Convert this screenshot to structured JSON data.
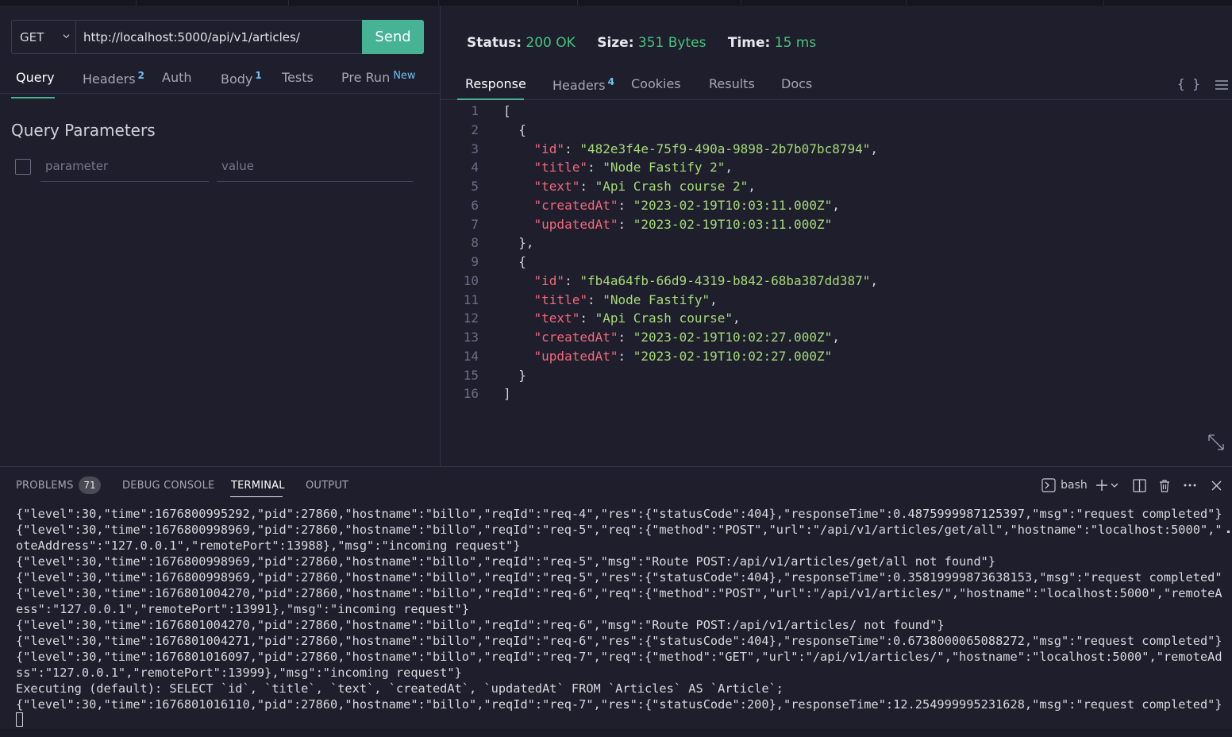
{
  "request": {
    "method": "GET",
    "url": "http://localhost:5000/api/v1/articles/",
    "send_label": "Send"
  },
  "request_tabs": [
    {
      "label": "Query",
      "count": ""
    },
    {
      "label": "Headers",
      "count": "2"
    },
    {
      "label": "Auth",
      "count": ""
    },
    {
      "label": "Body",
      "count": "1"
    },
    {
      "label": "Tests",
      "count": ""
    },
    {
      "label": "Pre Run",
      "count": "",
      "tag": "New"
    }
  ],
  "query_params": {
    "title": "Query Parameters",
    "param_placeholder": "parameter",
    "value_placeholder": "value"
  },
  "response_meta": {
    "status_label": "Status:",
    "status_value": "200 OK",
    "size_label": "Size:",
    "size_value": "351 Bytes",
    "time_label": "Time:",
    "time_value": "15 ms"
  },
  "response_tabs": [
    {
      "label": "Response",
      "count": ""
    },
    {
      "label": "Headers",
      "count": "4"
    },
    {
      "label": "Cookies",
      "count": ""
    },
    {
      "label": "Results",
      "count": ""
    },
    {
      "label": "Docs",
      "count": ""
    }
  ],
  "response_icons": {
    "format": "{ }",
    "menu": "menu-icon",
    "expand": "expand-icon"
  },
  "response_lines": [
    {
      "n": "1",
      "indent": "",
      "key": "",
      "value": "",
      "raw": "["
    },
    {
      "n": "2",
      "indent": "  ",
      "key": "",
      "value": "",
      "raw": "{"
    },
    {
      "n": "3",
      "indent": "    ",
      "key": "\"id\"",
      "value": "\"482e3f4e-75f9-490a-9898-2b7b07bc8794\"",
      "end": ","
    },
    {
      "n": "4",
      "indent": "    ",
      "key": "\"title\"",
      "value": "\"Node Fastify 2\"",
      "end": ","
    },
    {
      "n": "5",
      "indent": "    ",
      "key": "\"text\"",
      "value": "\"Api Crash course 2\"",
      "end": ","
    },
    {
      "n": "6",
      "indent": "    ",
      "key": "\"createdAt\"",
      "value": "\"2023-02-19T10:03:11.000Z\"",
      "end": ","
    },
    {
      "n": "7",
      "indent": "    ",
      "key": "\"updatedAt\"",
      "value": "\"2023-02-19T10:03:11.000Z\"",
      "end": ""
    },
    {
      "n": "8",
      "indent": "  ",
      "key": "",
      "value": "",
      "raw": "},"
    },
    {
      "n": "9",
      "indent": "  ",
      "key": "",
      "value": "",
      "raw": "{"
    },
    {
      "n": "10",
      "indent": "    ",
      "key": "\"id\"",
      "value": "\"fb4a64fb-66d9-4319-b842-68ba387dd387\"",
      "end": ","
    },
    {
      "n": "11",
      "indent": "    ",
      "key": "\"title\"",
      "value": "\"Node Fastify\"",
      "end": ","
    },
    {
      "n": "12",
      "indent": "    ",
      "key": "\"text\"",
      "value": "\"Api Crash course\"",
      "end": ","
    },
    {
      "n": "13",
      "indent": "    ",
      "key": "\"createdAt\"",
      "value": "\"2023-02-19T10:02:27.000Z\"",
      "end": ","
    },
    {
      "n": "14",
      "indent": "    ",
      "key": "\"updatedAt\"",
      "value": "\"2023-02-19T10:02:27.000Z\"",
      "end": ""
    },
    {
      "n": "15",
      "indent": "  ",
      "key": "",
      "value": "",
      "raw": "}"
    },
    {
      "n": "16",
      "indent": "",
      "key": "",
      "value": "",
      "raw": "]"
    }
  ],
  "panel": {
    "tabs": [
      "PROBLEMS",
      "DEBUG CONSOLE",
      "TERMINAL",
      "OUTPUT"
    ],
    "problems_count": "71",
    "active_tab": "TERMINAL",
    "shell": "bash"
  },
  "terminal_lines": [
    "{\"level\":30,\"time\":1676800995292,\"pid\":27860,\"hostname\":\"billo\",\"reqId\":\"req-4\",\"res\":{\"statusCode\":404},\"responseTime\":0.4875999987125397,\"msg\":\"request completed\"}",
    "{\"level\":30,\"time\":1676800998969,\"pid\":27860,\"hostname\":\"billo\",\"reqId\":\"req-5\",\"req\":{\"method\":\"POST\",\"url\":\"/api/v1/articles/get/all\",\"hostname\":\"localhost:5000\",\"rem",
    "oteAddress\":\"127.0.0.1\",\"remotePort\":13988},\"msg\":\"incoming request\"}",
    "{\"level\":30,\"time\":1676800998969,\"pid\":27860,\"hostname\":\"billo\",\"reqId\":\"req-5\",\"msg\":\"Route POST:/api/v1/articles/get/all not found\"}",
    "{\"level\":30,\"time\":1676800998969,\"pid\":27860,\"hostname\":\"billo\",\"reqId\":\"req-5\",\"res\":{\"statusCode\":404},\"responseTime\":0.35819999873638153,\"msg\":\"request completed\"}",
    "{\"level\":30,\"time\":1676801004270,\"pid\":27860,\"hostname\":\"billo\",\"reqId\":\"req-6\",\"req\":{\"method\":\"POST\",\"url\":\"/api/v1/articles/\",\"hostname\":\"localhost:5000\",\"remoteAddr",
    "ess\":\"127.0.0.1\",\"remotePort\":13991},\"msg\":\"incoming request\"}",
    "{\"level\":30,\"time\":1676801004270,\"pid\":27860,\"hostname\":\"billo\",\"reqId\":\"req-6\",\"msg\":\"Route POST:/api/v1/articles/ not found\"}",
    "{\"level\":30,\"time\":1676801004271,\"pid\":27860,\"hostname\":\"billo\",\"reqId\":\"req-6\",\"res\":{\"statusCode\":404},\"responseTime\":0.6738000065088272,\"msg\":\"request completed\"}",
    "{\"level\":30,\"time\":1676801016097,\"pid\":27860,\"hostname\":\"billo\",\"reqId\":\"req-7\",\"req\":{\"method\":\"GET\",\"url\":\"/api/v1/articles/\",\"hostname\":\"localhost:5000\",\"remoteAddre",
    "ss\":\"127.0.0.1\",\"remotePort\":13999},\"msg\":\"incoming request\"}",
    "Executing (default): SELECT `id`, `title`, `text`, `createdAt`, `updatedAt` FROM `Articles` AS `Article`;",
    "{\"level\":30,\"time\":1676801016110,\"pid\":27860,\"hostname\":\"billo\",\"reqId\":\"req-7\",\"res\":{\"statusCode\":200},\"responseTime\":12.254999995231628,\"msg\":\"request completed\"}"
  ],
  "colors": {
    "accent": "#46b394",
    "status_ok": "#46c47e",
    "json_key": "#f2697b",
    "json_string": "#a6da77",
    "badge_count": "#6dc3f2",
    "background": "#1e1e2c"
  }
}
